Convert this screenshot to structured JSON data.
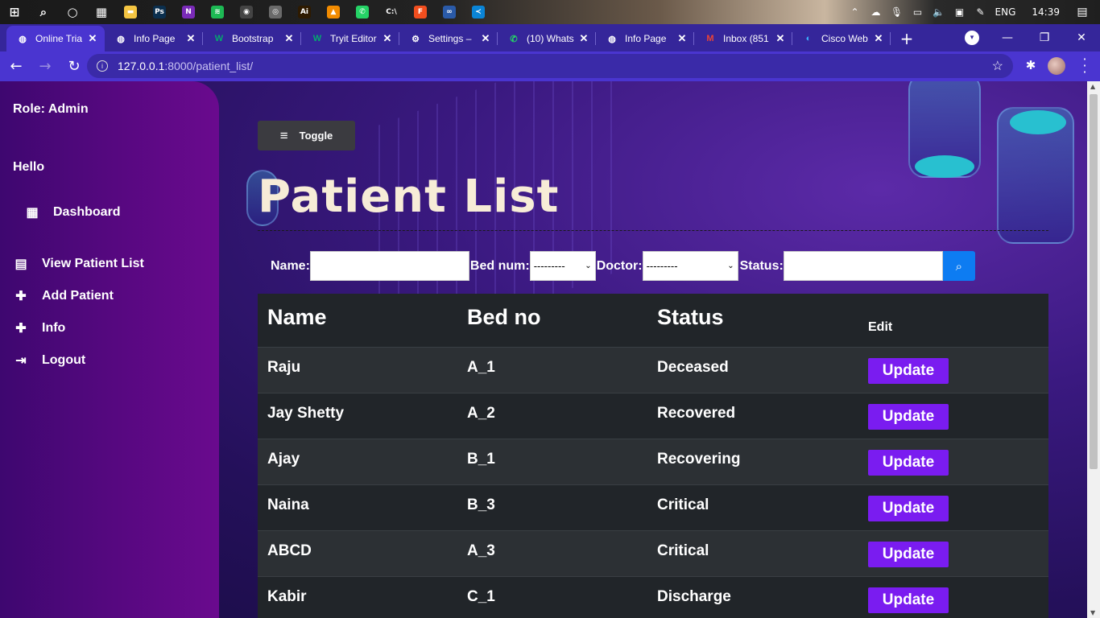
{
  "taskbar": {
    "apps": [
      {
        "name": "windows-start-icon",
        "color": "#ffffff",
        "glyph": "⊞"
      },
      {
        "name": "search-icon",
        "color": "#ffffff",
        "glyph": "⌕"
      },
      {
        "name": "cortana-icon",
        "color": "#ffffff",
        "glyph": "○"
      },
      {
        "name": "task-view-icon",
        "color": "#ffffff",
        "glyph": "▦"
      },
      {
        "name": "file-explorer-icon",
        "color": "#f4c542",
        "glyph": "▬"
      },
      {
        "name": "photoshop-icon",
        "color": "#0b2f4e",
        "glyph": "Ps"
      },
      {
        "name": "onenote-icon",
        "color": "#7a2bb8",
        "glyph": "N"
      },
      {
        "name": "spotify-icon",
        "color": "#1db954",
        "glyph": "≋"
      },
      {
        "name": "obs-icon",
        "color": "#444444",
        "glyph": "◉"
      },
      {
        "name": "chrome-icon",
        "color": "#6a6a6a",
        "glyph": "◎"
      },
      {
        "name": "illustrator-icon",
        "color": "#2e1a00",
        "glyph": "Ai"
      },
      {
        "name": "vlc-icon",
        "color": "#f28b00",
        "glyph": "▲"
      },
      {
        "name": "whatsapp-icon",
        "color": "#25d366",
        "glyph": "✆"
      },
      {
        "name": "terminal-icon",
        "color": "#222222",
        "glyph": "C:\\"
      },
      {
        "name": "figma-icon",
        "color": "#f24e1e",
        "glyph": "F"
      },
      {
        "name": "dev-tool-icon",
        "color": "#2a5aa8",
        "glyph": "∞"
      },
      {
        "name": "vscode-icon",
        "color": "#0a84d6",
        "glyph": "≺"
      }
    ],
    "tray": {
      "language": "ENG",
      "time": "14:39"
    }
  },
  "browser": {
    "tabs": [
      {
        "title": "Online Tria",
        "favicon": "globe-icon",
        "active": true
      },
      {
        "title": "Info Page",
        "favicon": "globe-icon",
        "active": false
      },
      {
        "title": "Bootstrap",
        "favicon": "w-logo-icon",
        "active": false
      },
      {
        "title": "Tryit Editor",
        "favicon": "w-logo-icon",
        "active": false
      },
      {
        "title": "Settings –",
        "favicon": "gear-icon",
        "active": false
      },
      {
        "title": "(10) Whats",
        "favicon": "whatsapp-icon",
        "active": false
      },
      {
        "title": "Info Page",
        "favicon": "globe-icon",
        "active": false
      },
      {
        "title": "Inbox (851",
        "favicon": "gmail-icon",
        "active": false
      },
      {
        "title": "Cisco Web",
        "favicon": "webex-icon",
        "active": false
      }
    ],
    "url_host": "127.0.0.1",
    "url_path": ":8000/patient_list/"
  },
  "sidebar": {
    "role": "Role: Admin",
    "greeting": "Hello",
    "links": [
      {
        "label": "Dashboard",
        "icon": "grid-icon"
      },
      {
        "label": "View Patient List",
        "icon": "id-card-icon"
      },
      {
        "label": "Add Patient",
        "icon": "plus-icon"
      },
      {
        "label": "Info",
        "icon": "plus-icon"
      },
      {
        "label": "Logout",
        "icon": "logout-icon"
      }
    ]
  },
  "main": {
    "toggle_label": "Toggle",
    "title": "Patient List",
    "filters": {
      "name_label": "Name:",
      "name_value": "",
      "bed_label": "Bed num:",
      "bed_selected": "---------",
      "doctor_label": "Doctor:",
      "doctor_selected": "---------",
      "status_label": "Status:",
      "status_value": ""
    },
    "table": {
      "headers": [
        "Name",
        "Bed no",
        "Status",
        "Edit"
      ],
      "rows": [
        {
          "name": "Raju",
          "bed": "A_1",
          "status": "Deceased",
          "action": "Update"
        },
        {
          "name": "Jay Shetty",
          "bed": "A_2",
          "status": "Recovered",
          "action": "Update"
        },
        {
          "name": "Ajay",
          "bed": "B_1",
          "status": "Recovering",
          "action": "Update"
        },
        {
          "name": "Naina",
          "bed": "B_3",
          "status": "Critical",
          "action": "Update"
        },
        {
          "name": "ABCD",
          "bed": "A_3",
          "status": "Critical",
          "action": "Update"
        },
        {
          "name": "Kabir",
          "bed": "C_1",
          "status": "Discharge",
          "action": "Update"
        }
      ]
    }
  },
  "colors": {
    "update_button": "#7a1cf0",
    "search_button": "#0d7cf2",
    "title_text": "#f7ecd7",
    "table_dark": "#212529"
  }
}
